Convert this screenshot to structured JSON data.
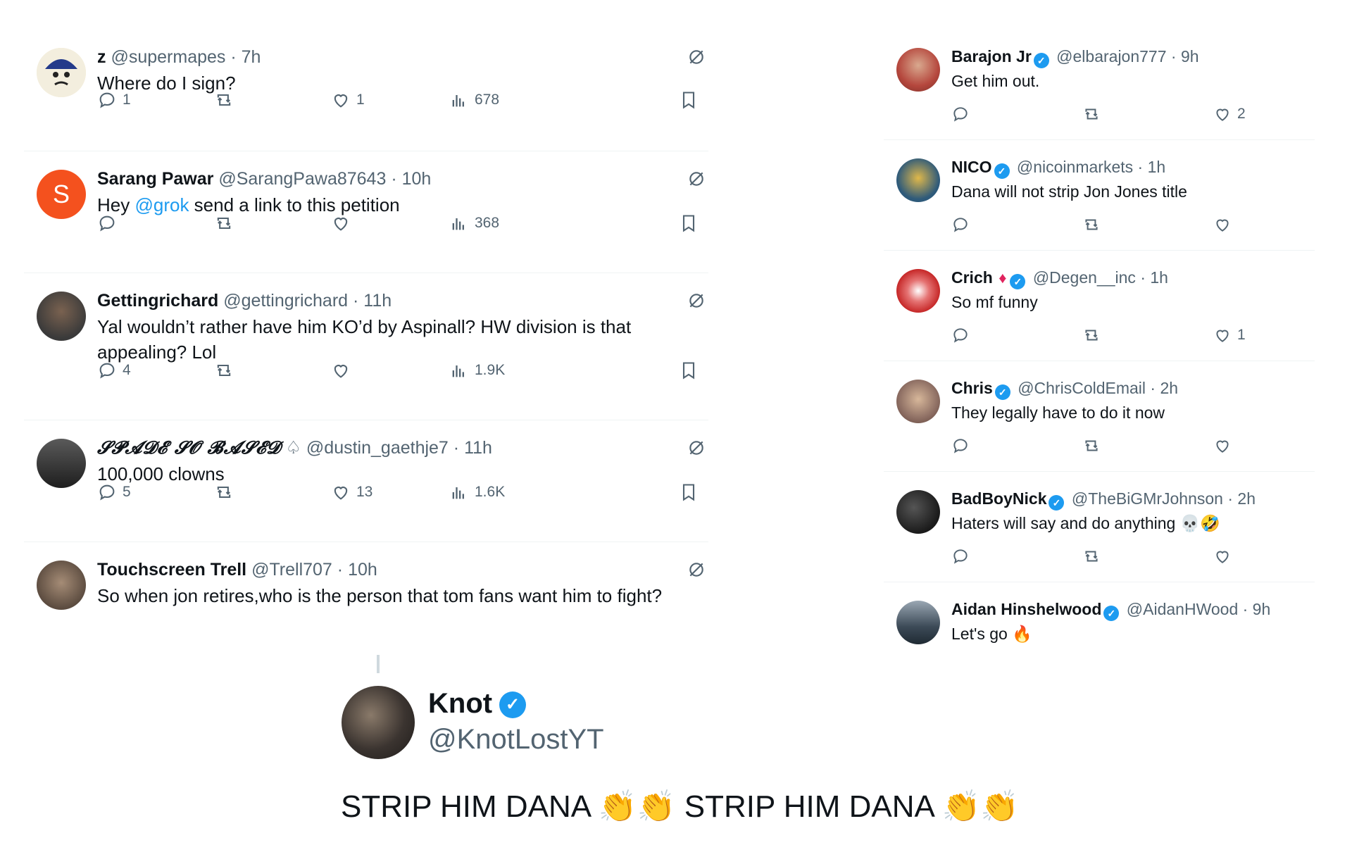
{
  "left_tweets": [
    {
      "name": "z",
      "handle": "@supermapes",
      "time": "· 7h",
      "text": "Where do I sign?",
      "reply_count": "1",
      "like_count": "1",
      "views": "678",
      "avatar_color": "#2f3e86"
    },
    {
      "name": "Sarang Pawar",
      "handle": "@SarangPawa87643",
      "time": "· 10h",
      "text_before": "Hey ",
      "mention": "@grok",
      "text_after": " send a link to this petition",
      "reply_count": "",
      "like_count": "",
      "views": "368",
      "avatar_letter": "S",
      "avatar_color": "#f4511e"
    },
    {
      "name": "Gettingrichard",
      "handle": "@gettingrichard",
      "time": "· 11h",
      "text": "Yal wouldn’t rather have him KO’d by Aspinall? HW division is that appealing? Lol",
      "reply_count": "4",
      "like_count": "",
      "views": "1.9K",
      "avatar_color": "#3a3a3a"
    },
    {
      "name": "𝓢𝓟𝓐𝓓𝓔 𝓢𝓞 𝓑𝓐𝓢𝓔𝓓",
      "handle": "@dustin_gaethje7",
      "time": "· 11h",
      "text": "100,000 clowns",
      "reply_count": "5",
      "like_count": "13",
      "views": "1.6K",
      "avatar_color": "#2a2a2a"
    },
    {
      "name": "Touchscreen Trell",
      "handle": "@Trell707",
      "time": "· 10h",
      "text": "So when jon retires,who is the person that tom fans want him to fight?",
      "avatar_color": "#6b5a4e"
    }
  ],
  "right_tweets": [
    {
      "name": "Barajon Jr",
      "handle": "@elbarajon777",
      "time": "· 9h",
      "text": "Get him out.",
      "like_count": "2",
      "avatar_color": "#b5473d"
    },
    {
      "name": "NICO",
      "handle": "@nicoinmarkets",
      "time": "· 1h",
      "text": "Dana will not strip Jon Jones title",
      "like_count": "",
      "avatar_color": "#2e5a7a"
    },
    {
      "name": "Crich",
      "handle": "@Degen__inc",
      "time": "· 1h",
      "text": "So mf funny",
      "like_count": "1",
      "avatar_color": "#c62828"
    },
    {
      "name": "Chris",
      "handle": "@ChrisColdEmail",
      "time": "· 2h",
      "text": "They legally have to do it now",
      "like_count": "",
      "avatar_color": "#8d6e63"
    },
    {
      "name": "BadBoyNick",
      "handle": "@TheBiGMrJohnson",
      "time": "· 2h",
      "text": "Haters will say and do anything 💀🤣",
      "like_count": "",
      "avatar_color": "#1a1a1a"
    },
    {
      "name": "Aidan Hinshelwood",
      "handle": "@AidanHWood",
      "time": "· 9h",
      "text": "Let's go 🔥",
      "avatar_color": "#3c4a57"
    }
  ],
  "knot": {
    "name": "Knot",
    "handle": "@KnotLostYT",
    "text": "STRIP HIM DANA 👏👏 STRIP HIM DANA 👏👏"
  },
  "colors": {
    "accent": "#1d9bf0",
    "muted": "#536471",
    "text": "#0f1419"
  },
  "icons": [
    "reply-icon",
    "retweet-icon",
    "like-icon",
    "views-icon",
    "bookmark-icon",
    "grok-icon",
    "verified-icon"
  ]
}
